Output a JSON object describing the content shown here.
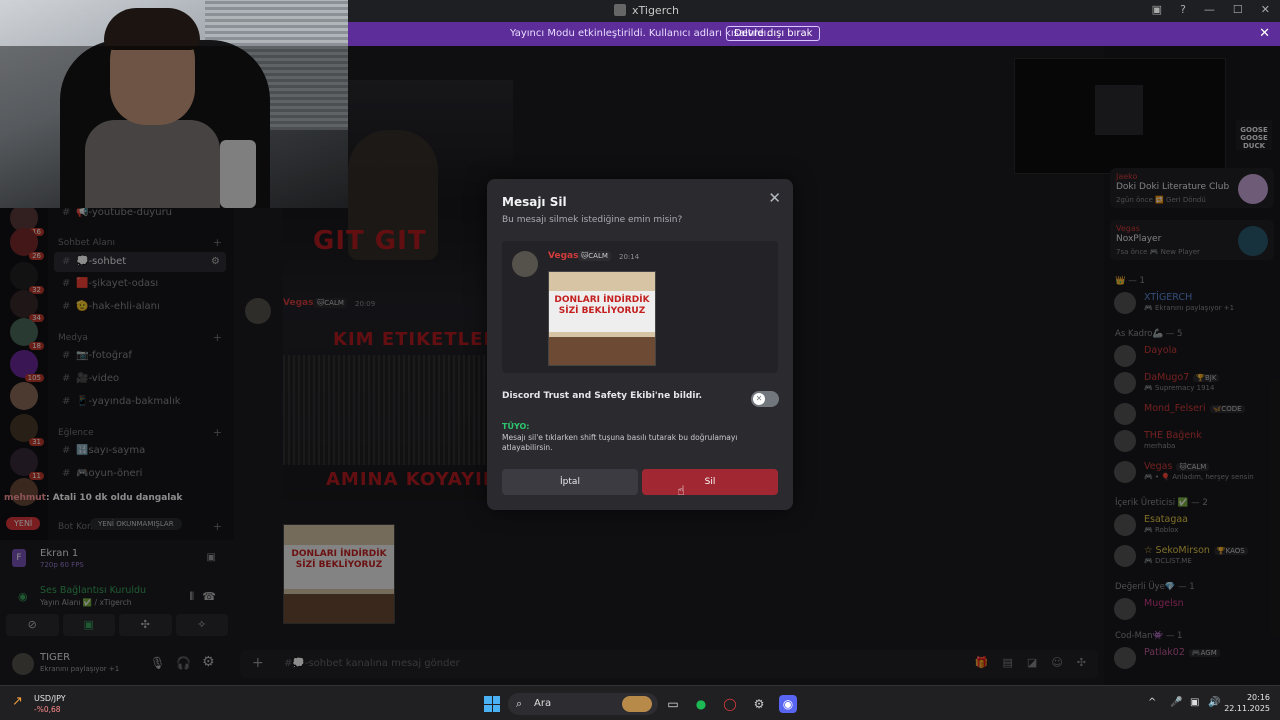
{
  "window": {
    "title": "xTigerch"
  },
  "banner": {
    "text": "Yayıncı Modu etkinleştirildi. Kullanıcı adları kısaltıldı.",
    "button": "Devre dışı bırak"
  },
  "servers": [
    {
      "badge": "16"
    },
    {
      "badge": "26"
    },
    {
      "badge": "32"
    },
    {
      "badge": "34"
    },
    {
      "badge": "18"
    },
    {
      "badge": "105"
    },
    {
      "badge": ""
    },
    {
      "badge": "31"
    },
    {
      "badge": "11"
    },
    {
      "badge": ""
    }
  ],
  "channels": {
    "partial_top": "📢-youtube-duyuru",
    "categories": [
      {
        "name": "Sohbet Alanı",
        "items": [
          "💭-sohbet",
          "🟥-şikayet-odası",
          "🫡-hak-ehli-alanı"
        ]
      },
      {
        "name": "Medya",
        "items": [
          "📷-fotoğraf",
          "🎥-video",
          "📱-yayında-bakmalık"
        ]
      },
      {
        "name": "Eğlence",
        "items": [
          "🔢sayı-sayma",
          "🎮oyun-öneri"
        ]
      },
      {
        "name": "Bot Kom",
        "items": []
      }
    ],
    "active": "💭-sohbet",
    "new_label": "YENİ",
    "unread_label": "YENİ OKUNMAMIŞLAR"
  },
  "chat_overlay": {
    "user": "mehmut",
    "text": ": Atali 10 dk oldu dangalak"
  },
  "user_panel": {
    "stream_name": "Ekran 1",
    "stream_quality": "720p 60 FPS",
    "voice_status": "Ses Bağlantısı Kuruldu",
    "voice_channel": "Yayın Alanı ✅ / xTigerch",
    "username": "TIGER",
    "user_status": "Ekranını paylaşıyor +1"
  },
  "main": {
    "video_texts": [
      "GIT GIT",
      "KIM ETIKETLEDI",
      "AMINA KOYAYIM"
    ],
    "message": {
      "user": "Vegas",
      "tag": "🐱CALM",
      "time": "20:09"
    },
    "image_sign": {
      "line1": "DONLARI İNDİRDİK",
      "line2": "SİZİ BEKLİYORUZ"
    },
    "composer_placeholder": "#💭-sohbet kanalına mesaj gönder"
  },
  "modal": {
    "title": "Mesajı Sil",
    "subtitle": "Bu mesajı silmek istediğine emin misin?",
    "preview": {
      "user": "Vegas",
      "tag": "🐱CALM",
      "time": "20:14"
    },
    "report_label": "Discord Trust and Safety Ekibi'ne bildir.",
    "report_enabled": false,
    "tip_header": "TÜYO:",
    "tip_text": "Mesajı sil'e tıklarken shift tuşuna basılı tutarak bu doğrulamayı atlayabilirsin.",
    "cancel": "İptal",
    "delete": "Sil",
    "delete_color": "#a12833"
  },
  "activities": [
    {
      "user": "Jaeko",
      "title": "Doki Doki Literature Club",
      "meta": "2gün önce 🔁 Geri Döndü"
    },
    {
      "user": "Vegas",
      "title": "NoxPlayer",
      "meta": "7sa önce 🎮 New Player"
    }
  ],
  "goose": "GOOSE GOOSE DUCK",
  "members": {
    "sections": [
      {
        "role": "👑 — 1",
        "members": [
          {
            "name": "XTİGERCH",
            "badge": "",
            "status": "🎮 Ekranını paylaşıyor +1",
            "color": "#5b8dd9"
          }
        ]
      },
      {
        "role": "As Kadro🦾 — 5",
        "members": [
          {
            "name": "Dayola",
            "badge": "",
            "status": "",
            "color": "#d23b3b"
          },
          {
            "name": "DaMugo7",
            "badge": "🏆BJK",
            "status": "🎮 Supremacy 1914",
            "color": "#d23b3b"
          },
          {
            "name": "Mond_Felseri",
            "badge": "🦋CODE",
            "status": "",
            "color": "#d23b3b"
          },
          {
            "name": "THE Bağenk",
            "badge": "",
            "status": "merhaba",
            "color": "#d23b3b"
          },
          {
            "name": "Vegas",
            "badge": "🐱CALM",
            "status": "🎮 • 🎈 Anladım, herşey sensin",
            "color": "#d23b3b"
          }
        ]
      },
      {
        "role": "İçerik Üreticisi ✅ — 2",
        "members": [
          {
            "name": "Esatagaa",
            "badge": "",
            "status": "🎮 Roblox",
            "color": "#e6c84a"
          },
          {
            "name": "☆ SekoMirson",
            "badge": "🏆KAOS",
            "status": "🎮 DCLIST.ME",
            "color": "#e6c84a"
          }
        ]
      },
      {
        "role": "Değerli Üye💎 — 1",
        "members": [
          {
            "name": "Mugelsn",
            "badge": "",
            "status": "",
            "color": "#d23b8a"
          }
        ]
      },
      {
        "role": "Cod-Man👾 — 1",
        "members": [
          {
            "name": "Patlak02",
            "badge": "🎮AGM",
            "status": "",
            "color": "#c45a9a"
          }
        ]
      }
    ]
  },
  "taskbar": {
    "stock_symbol": "USD/JPY",
    "stock_change": "-%0,68",
    "search": "Ara",
    "time": "20:16",
    "date": "22.11.2025"
  }
}
